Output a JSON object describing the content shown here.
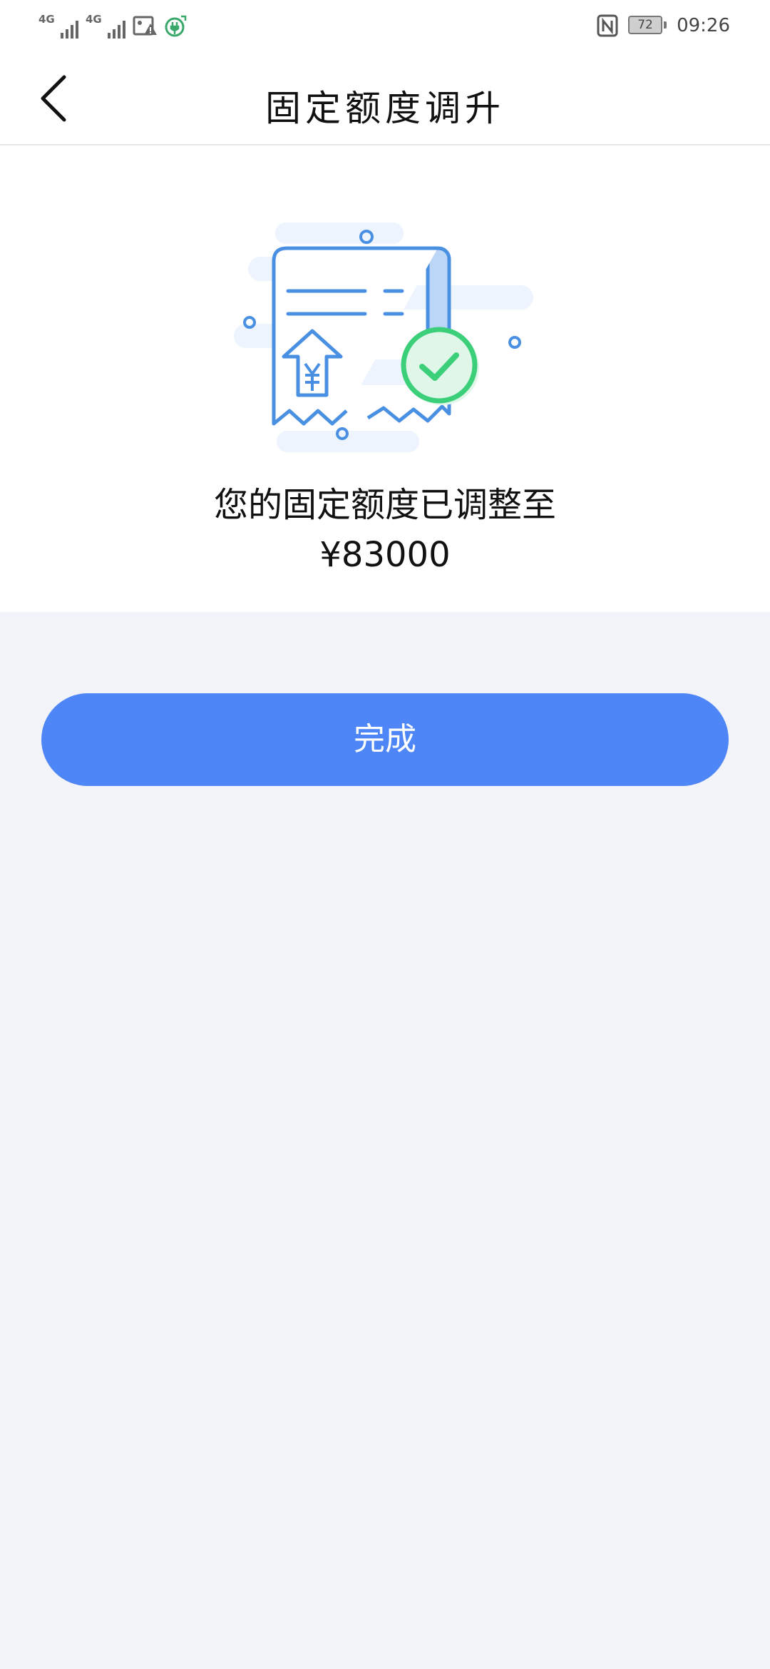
{
  "status_bar": {
    "signal_1": "4G",
    "signal_2": "4G",
    "battery_level": "72",
    "time": "09:26",
    "icons": [
      "signal-icon",
      "signal-icon",
      "image-warning-icon",
      "charging-icon",
      "nfc-icon",
      "battery-icon"
    ]
  },
  "header": {
    "title": "固定额度调升",
    "back_icon": "chevron-left-icon"
  },
  "result": {
    "message": "您的固定额度已调整至",
    "amount": "¥83000",
    "illustration": "receipt-success-illustration"
  },
  "actions": {
    "done_label": "完成"
  },
  "colors": {
    "accent": "#4f86f7",
    "page_background": "#f2f4f9",
    "card_background": "#ffffff",
    "success_green": "#3ccf7a",
    "illustration_blue": "#4a90e2"
  }
}
